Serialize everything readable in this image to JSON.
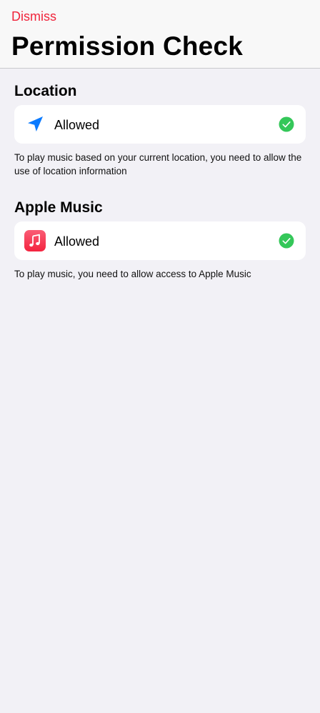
{
  "header": {
    "dismiss_label": "Dismiss",
    "title": "Permission Check"
  },
  "sections": [
    {
      "title": "Location",
      "status": "Allowed",
      "icon": "location-arrow-icon",
      "description": "To play music based on your current location, you need to allow the use of location information"
    },
    {
      "title": "Apple Music",
      "status": "Allowed",
      "icon": "apple-music-icon",
      "description": "To play music, you need to allow access to Apple Music"
    }
  ],
  "colors": {
    "accent_red": "#f0243b",
    "check_green": "#34c759",
    "location_blue": "#0a7aff",
    "background": "#f2f1f6"
  }
}
